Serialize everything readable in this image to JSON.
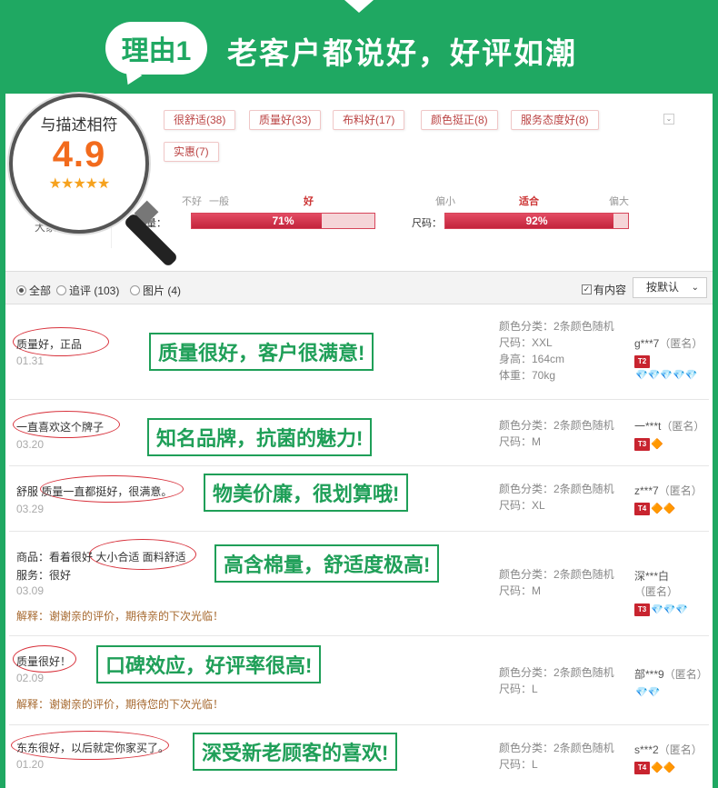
{
  "banner": {
    "badge": "理由1",
    "headline": "老客户都说好，好评如潮"
  },
  "rating": {
    "label": "与描述相符",
    "score": "4.9",
    "stars": "★★★★★",
    "under_label": "大家认为"
  },
  "tags": [
    "很舒适(38)",
    "质量好(33)",
    "布料好(17)",
    "颜色挺正(8)",
    "服务态度好(8)",
    "实惠(7)"
  ],
  "quality_bar": {
    "label": "质量：",
    "scale": [
      "不好",
      "一般",
      "好"
    ],
    "active": "好",
    "percent_text": "71%",
    "percent": 0.71
  },
  "size_bar": {
    "label": "尺码：",
    "scale": [
      "偏小",
      "适合",
      "偏大"
    ],
    "active": "适合",
    "percent_text": "92%",
    "percent": 0.92
  },
  "filter": {
    "all": "全部",
    "followup": "追评 (103)",
    "pictures": "图片 (4)",
    "has_content": "有内容",
    "sort": "按默认"
  },
  "reviews": [
    {
      "text": "质量好，正品",
      "date": "01.31",
      "callout": "质量很好，客户很满意!",
      "sku": [
        "颜色分类：2条颜色随机",
        "尺码：XXL",
        "身高：164cm",
        "体重：70kg"
      ],
      "user": "g***7",
      "anon": "（匿名）",
      "level": "T2",
      "gems": "💎💎💎💎💎"
    },
    {
      "text": "一直喜欢这个牌子",
      "date": "03.20",
      "callout": "知名品牌，抗菌的魅力!",
      "sku": [
        "颜色分类：2条颜色随机",
        "尺码：M"
      ],
      "user": "一***t",
      "anon": "（匿名）",
      "level": "T3",
      "gems": "🔶"
    },
    {
      "text": "舒服 质量一直都挺好，很满意。",
      "date": "03.29",
      "callout": "物美价廉，很划算哦!",
      "sku": [
        "颜色分类：2条颜色随机",
        "尺码：XL"
      ],
      "user": "z***7",
      "anon": "（匿名）",
      "level": "T4",
      "gems": "🔶🔶"
    },
    {
      "text": "商品：看着很好 大小合适 面料舒适",
      "text2": "服务：很好",
      "date": "03.09",
      "reply": "解释：谢谢亲的评价，期待亲的下次光临！",
      "callout": "高含棉量，舒适度极高!",
      "sku": [
        "颜色分类：2条颜色随机",
        "尺码：M"
      ],
      "user": "深***白",
      "anon": "（匿名）",
      "level": "T3",
      "gems": "💎💎💎"
    },
    {
      "text": "质量很好！",
      "date": "02.09",
      "reply": "解释：谢谢亲的评价，期待您的下次光临！",
      "callout": "口碑效应，好评率很高!",
      "sku": [
        "颜色分类：2条颜色随机",
        "尺码：L"
      ],
      "user": "部***9",
      "anon": "（匿名）",
      "level": "",
      "gems": "💎💎"
    },
    {
      "text": "东东很好，以后就定你家买了。",
      "date": "01.20",
      "callout": "深受新老顾客的喜欢!",
      "sku": [
        "颜色分类：2条颜色随机",
        "尺码：L"
      ],
      "user": "s***2",
      "anon": "（匿名）",
      "level": "T4",
      "gems": "🔶🔶"
    }
  ],
  "colors": {
    "brand_green": "#1fa862",
    "accent_red": "#d6455a",
    "score_orange": "#f26b1d"
  }
}
